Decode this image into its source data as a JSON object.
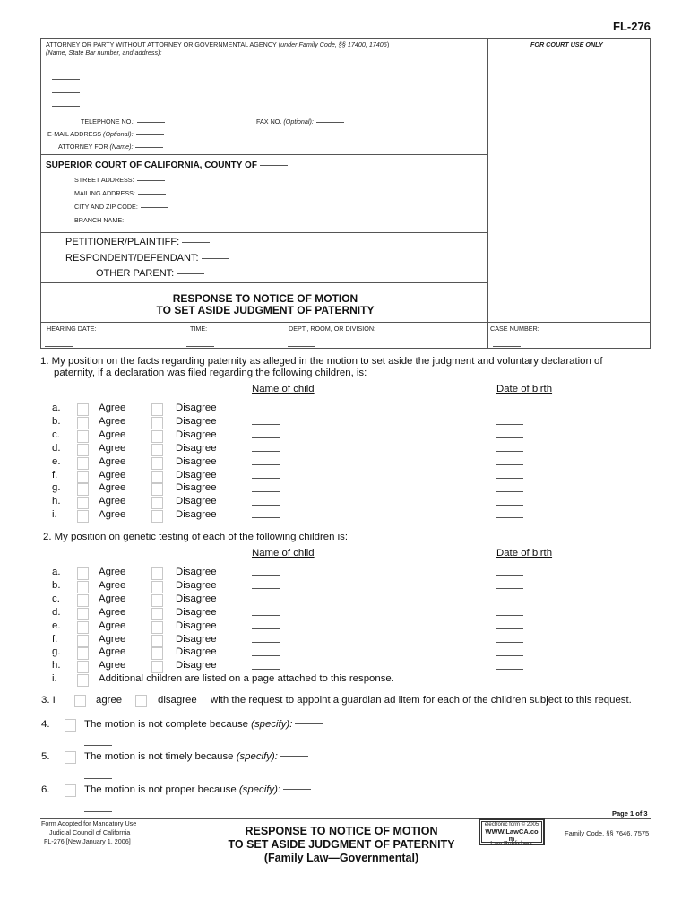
{
  "form_number": "FL-276",
  "header": {
    "attorney_label": "ATTORNEY OR PARTY WITHOUT ATTORNEY OR GOVERNMENTAL AGENCY (",
    "attorney_label_italic": "under Family Code, §§ 17400, 17406",
    "attorney_label_close": ")",
    "attorney_sub_label": "(Name, State Bar number, and address):",
    "court_use_only": "FOR COURT USE ONLY",
    "telephone_label": "TELEPHONE NO.:",
    "fax_label": "FAX NO. ",
    "fax_optional": "(Optional):",
    "email_label": "E-MAIL ADDRESS ",
    "email_optional": "(Optional):",
    "attorney_for_label": "ATTORNEY FOR ",
    "attorney_for_name": "(Name):",
    "court_title": "SUPERIOR COURT OF CALIFORNIA, COUNTY OF",
    "street_address_label": "STREET ADDRESS:",
    "mailing_address_label": "MAILING ADDRESS:",
    "city_zip_label": "CITY AND ZIP CODE:",
    "branch_name_label": "BRANCH NAME:",
    "petitioner_label": "PETITIONER/PLAINTIFF:",
    "respondent_label": "RESPONDENT/DEFENDANT:",
    "other_parent_label": "OTHER PARENT:",
    "title_line1": "RESPONSE TO NOTICE OF MOTION",
    "title_line2": "TO SET ASIDE JUDGMENT OF PATERNITY",
    "hearing_date_label": "HEARING DATE:",
    "time_label": "TIME:",
    "dept_label": "DEPT., ROOM, OR DIVISION:",
    "case_number_label": "CASE NUMBER:"
  },
  "section1": {
    "text_line1": "1.  My position on the facts regarding paternity as alleged in the motion to set aside the judgment and voluntary declaration of",
    "text_line2": "paternity, if a declaration was filed regarding the following children, is:",
    "name_header": "Name of child",
    "dob_header": "Date of birth",
    "rows": [
      {
        "letter": "a.",
        "agree": "Agree",
        "disagree": "Disagree"
      },
      {
        "letter": "b.",
        "agree": "Agree",
        "disagree": "Disagree"
      },
      {
        "letter": "c.",
        "agree": "Agree",
        "disagree": "Disagree"
      },
      {
        "letter": "d.",
        "agree": "Agree",
        "disagree": "Disagree"
      },
      {
        "letter": "e.",
        "agree": "Agree",
        "disagree": "Disagree"
      },
      {
        "letter": "f.",
        "agree": "Agree",
        "disagree": "Disagree"
      },
      {
        "letter": "g.",
        "agree": "Agree",
        "disagree": "Disagree"
      },
      {
        "letter": "h.",
        "agree": "Agree",
        "disagree": "Disagree"
      },
      {
        "letter": "i.",
        "agree": "Agree",
        "disagree": "Disagree"
      }
    ]
  },
  "section2": {
    "text": "2.   My position on genetic testing of each of the following children is:",
    "name_header": "Name of child",
    "dob_header": "Date of birth",
    "rows": [
      {
        "letter": "a.",
        "agree": "Agree",
        "disagree": "Disagree"
      },
      {
        "letter": "b.",
        "agree": "Agree",
        "disagree": "Disagree"
      },
      {
        "letter": "c.",
        "agree": "Agree",
        "disagree": "Disagree"
      },
      {
        "letter": "d.",
        "agree": "Agree",
        "disagree": "Disagree"
      },
      {
        "letter": "e.",
        "agree": "Agree",
        "disagree": "Disagree"
      },
      {
        "letter": "f.",
        "agree": "Agree",
        "disagree": "Disagree"
      },
      {
        "letter": "g.",
        "agree": "Agree",
        "disagree": "Disagree"
      },
      {
        "letter": "h.",
        "agree": "Agree",
        "disagree": "Disagree"
      }
    ],
    "last_letter": "i.",
    "additional_text": "Additional children are listed on a page attached to this response."
  },
  "section3": {
    "number": "3.  I",
    "agree": "agree",
    "disagree": "disagree",
    "text": "with the request to appoint a guardian ad litem for each of the children subject to this request."
  },
  "section4": {
    "number": "4.",
    "text": "The motion is not complete because ",
    "specify": "(specify):"
  },
  "section5": {
    "number": "5.",
    "text": "The motion is not timely because ",
    "specify": "(specify):"
  },
  "section6": {
    "number": "6.",
    "text": "The motion is not proper because ",
    "specify": "(specify):"
  },
  "footer": {
    "page": "Page 1 of 3",
    "adopted_line1": "Form Adopted for Mandatory Use",
    "adopted_line2": "Judicial Council of California",
    "adopted_line3": "FL-276 [New January 1, 2006]",
    "title_line1": "RESPONSE TO NOTICE OF MOTION",
    "title_line2": "TO SET ASIDE JUDGMENT OF PATERNITY",
    "title_line3": "(Family Law—Governmental)",
    "stamp_line1": "electronic form © 2005",
    "stamp_line2": "WWW.LawCA.co",
    "stamp_line3": "m",
    "stamp_line4": "Law Publishers",
    "code_ref": "Family Code, §§ 7646, 7575"
  }
}
